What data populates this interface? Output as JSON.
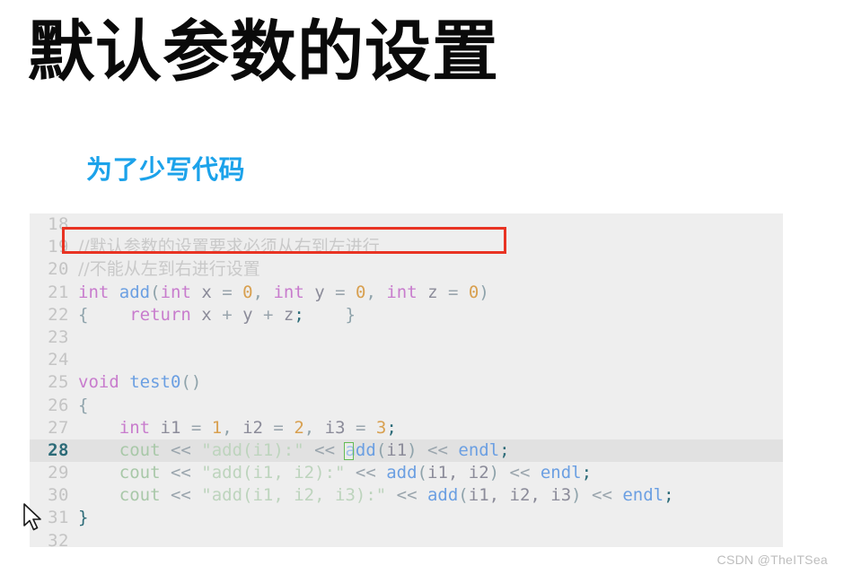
{
  "slide": {
    "title": "默认参数的设置",
    "subtitle": "为了少写代码"
  },
  "watermark": "CSDN @TheITSea",
  "code_panel": {
    "background_color": "#eeeeee",
    "active_line": 28,
    "annotation_box_color": "#e83323",
    "caret_box_color": "#63bb55",
    "lines": [
      {
        "num": "18",
        "text": ""
      },
      {
        "num": "19",
        "text": "//默认参数的设置要求必须从右到左进行"
      },
      {
        "num": "20",
        "text": "//不能从左到右进行设置"
      },
      {
        "num": "21",
        "text": "int add(int x = 0, int y = 0, int z = 0)"
      },
      {
        "num": "22",
        "text": "{    return x + y + z;    }"
      },
      {
        "num": "23",
        "text": ""
      },
      {
        "num": "24",
        "text": ""
      },
      {
        "num": "25",
        "text": "void test0()"
      },
      {
        "num": "26",
        "text": "{"
      },
      {
        "num": "27",
        "text": "    int i1 = 1, i2 = 2, i3 = 3;"
      },
      {
        "num": "28",
        "text": "    cout << \"add(i1):\" << add(i1) << endl;"
      },
      {
        "num": "29",
        "text": "    cout << \"add(i1, i2):\" << add(i1, i2) << endl;"
      },
      {
        "num": "30",
        "text": "    cout << \"add(i1, i2, i3):\" << add(i1, i2, i3) << endl;"
      },
      {
        "num": "31",
        "text": "}"
      },
      {
        "num": "32",
        "text": ""
      }
    ]
  },
  "colors": {
    "title": "#0a0a0a",
    "subtitle": "#1ba2ea",
    "comment": "#c9c9c9",
    "keyword": "#c87ccd",
    "function": "#6b9fe2",
    "number": "#d8a050",
    "string": "#bdd4bd",
    "stream": "#a8c8a8",
    "line_number": "#c4c4c4",
    "active_line_number": "#2c6b78",
    "active_line_bg": "#e1e1e1"
  }
}
